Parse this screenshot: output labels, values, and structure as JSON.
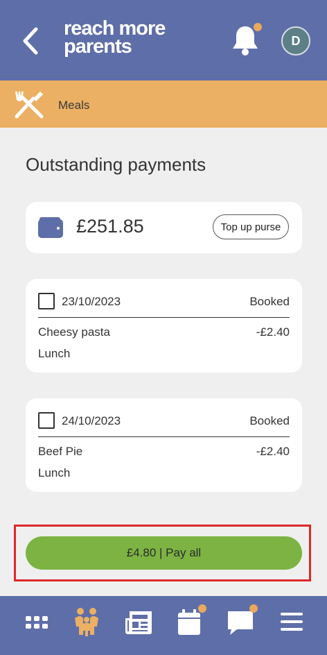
{
  "header": {
    "logo_line1": "reach more",
    "logo_line2": "parents",
    "avatar_initial": "D",
    "back_icon": "chevron-left-icon",
    "bell_icon": "bell-icon"
  },
  "section": {
    "label": "Meals",
    "icon": "cutlery-icon"
  },
  "page": {
    "title": "Outstanding payments"
  },
  "wallet": {
    "balance": "£251.85",
    "topup_label": "Top up purse",
    "icon": "wallet-icon"
  },
  "orders": [
    {
      "date": "23/10/2023",
      "status": "Booked",
      "item": "Cheesy pasta",
      "price": "-£2.40",
      "meal": "Lunch"
    },
    {
      "date": "24/10/2023",
      "status": "Booked",
      "item": "Beef Pie",
      "price": "-£2.40",
      "meal": "Lunch"
    }
  ],
  "pay_all": {
    "label": "£4.80 | Pay all"
  },
  "bottom_nav": {
    "items": [
      "grid-icon",
      "family-icon",
      "newspaper-icon",
      "calendar-icon",
      "chat-icon",
      "menu-icon"
    ]
  },
  "colors": {
    "header": "#5e6ea8",
    "section_bar": "#ebb063",
    "pay_button": "#7cb342",
    "notification_dot": "#e9a85c",
    "highlight": "#e0262a"
  }
}
